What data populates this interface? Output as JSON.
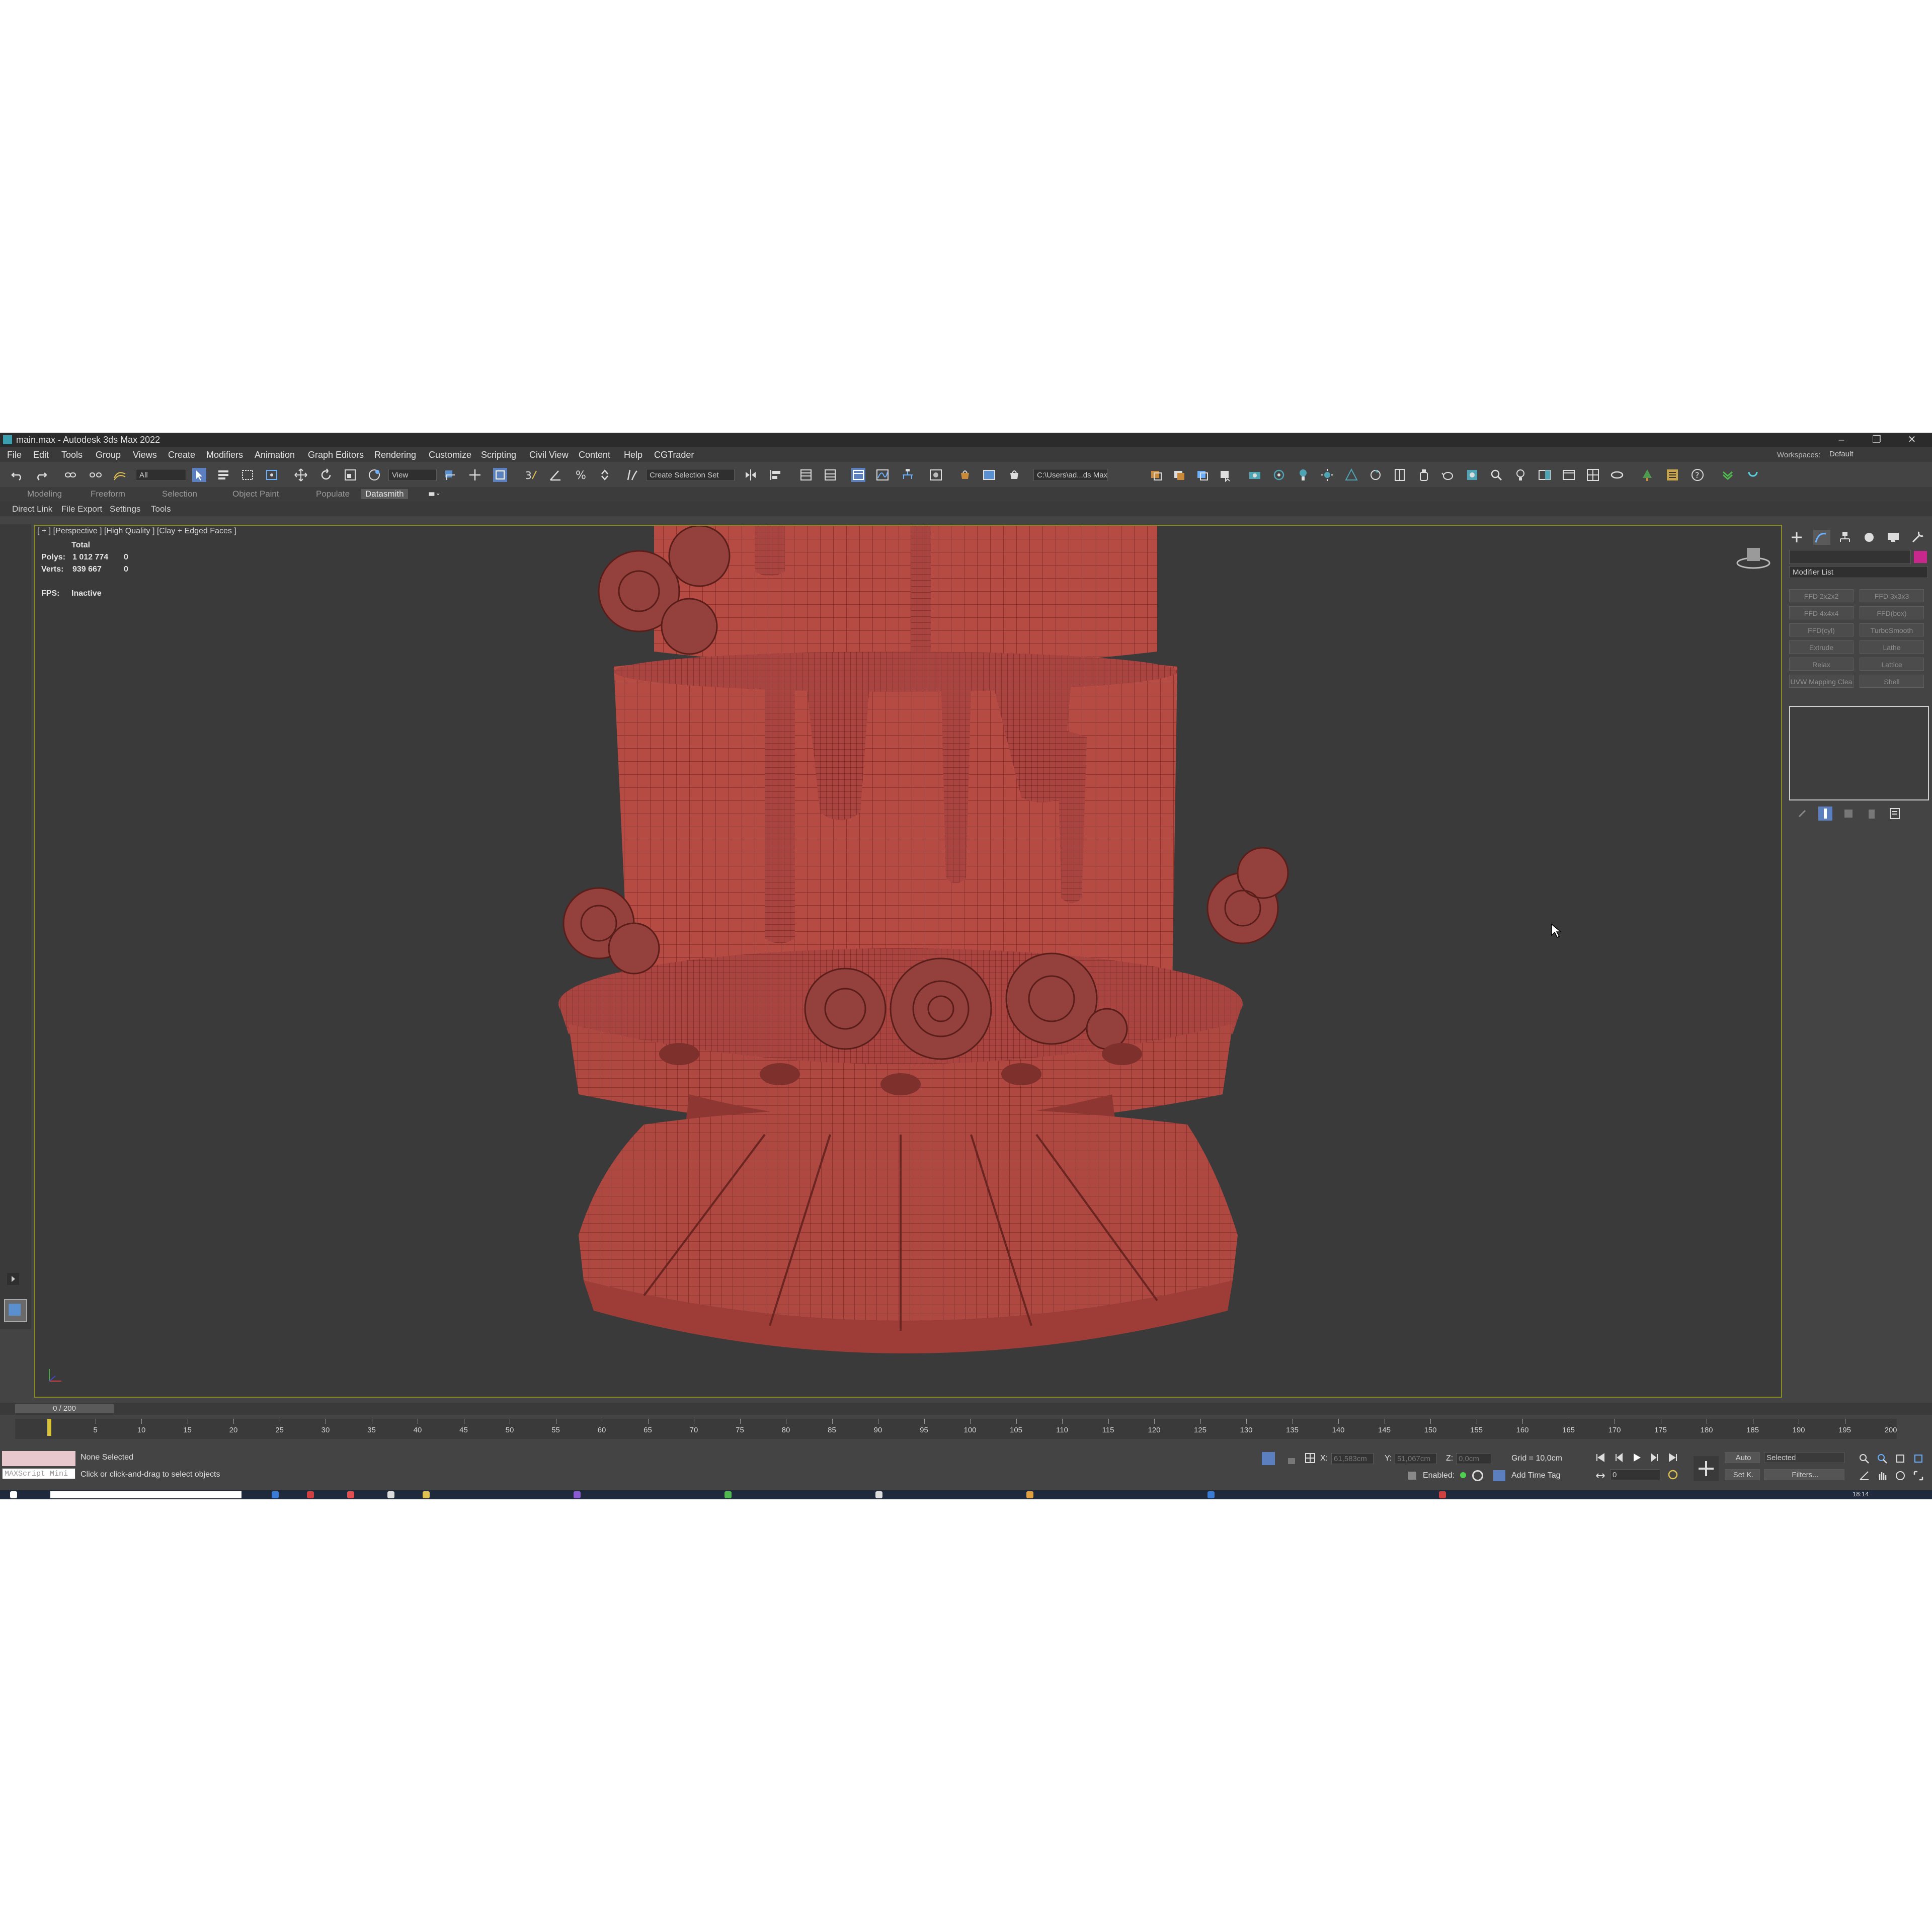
{
  "window": {
    "title": "main.max - Autodesk 3ds Max 2022",
    "minimize": "–",
    "maximize": "❐",
    "close": "✕"
  },
  "menu": {
    "items": [
      "File",
      "Edit",
      "Tools",
      "Group",
      "Views",
      "Create",
      "Modifiers",
      "Animation",
      "Graph Editors",
      "Rendering",
      "Customize",
      "Scripting",
      "Civil View",
      "Content",
      "Help",
      "CGTrader"
    ]
  },
  "workspaces": {
    "label": "Workspaces:",
    "value": "Default"
  },
  "toolbar": {
    "filter_value": "All",
    "coord_value": "View",
    "selection_set_placeholder": "Create Selection Set",
    "project_path": "C:\\Users\\ad...ds Max 2022"
  },
  "ribbon_tabs": [
    "Modeling",
    "Freeform",
    "Selection",
    "Object Paint",
    "Populate",
    "Datasmith"
  ],
  "ribbon_active": "Datasmith",
  "sub_tabs": [
    "Direct Link",
    "File Export",
    "Settings",
    "Tools"
  ],
  "viewport": {
    "label": "[ + ] [Perspective ] [High Quality ] [Clay + Edged Faces ]",
    "stats_header": "Total",
    "polys_label": "Polys:",
    "polys_total": "1 012 774",
    "polys_sel": "0",
    "verts_label": "Verts:",
    "verts_total": "939 667",
    "verts_sel": "0",
    "fps_label": "FPS:",
    "fps_value": "Inactive",
    "model_color": "#b54b43",
    "background": "#3a3a3a"
  },
  "command_panel": {
    "modifier_list_label": "Modifier List",
    "buttons": [
      "FFD 2x2x2",
      "FFD 3x3x3",
      "FFD 4x4x4",
      "FFD(box)",
      "FFD(cyl)",
      "TurboSmooth",
      "Extrude",
      "Lathe",
      "Relax",
      "Lattice",
      "UVW Mapping Clea",
      "Shell"
    ],
    "object_color": "#c8288c"
  },
  "timeline": {
    "frame_label": "0 / 200",
    "ticks": [
      "5",
      "10",
      "15",
      "20",
      "25",
      "30",
      "35",
      "40",
      "45",
      "50",
      "55",
      "60",
      "65",
      "70",
      "75",
      "80",
      "85",
      "90",
      "95",
      "100",
      "105",
      "110",
      "115",
      "120",
      "125",
      "130",
      "135",
      "140",
      "145",
      "150",
      "155",
      "160",
      "165",
      "170",
      "175",
      "180",
      "185",
      "190",
      "195",
      "200"
    ]
  },
  "status": {
    "maxscript": "MAXScript Mini",
    "selection": "None Selected",
    "prompt": "Click or click-and-drag to select objects",
    "x_label": "X:",
    "x_value": "61,583cm",
    "y_label": "Y:",
    "y_value": "51,067cm",
    "z_label": "Z:",
    "z_value": "0,0cm",
    "grid": "Grid = 10,0cm",
    "enabled": "Enabled:",
    "add_time_tag": "Add Time Tag",
    "auto": "Auto",
    "set_key": "Set K.",
    "key_filter_value": "Selected",
    "filters": "Filters...",
    "frame_value": "0"
  },
  "taskbar": {
    "clock": "18:14"
  }
}
